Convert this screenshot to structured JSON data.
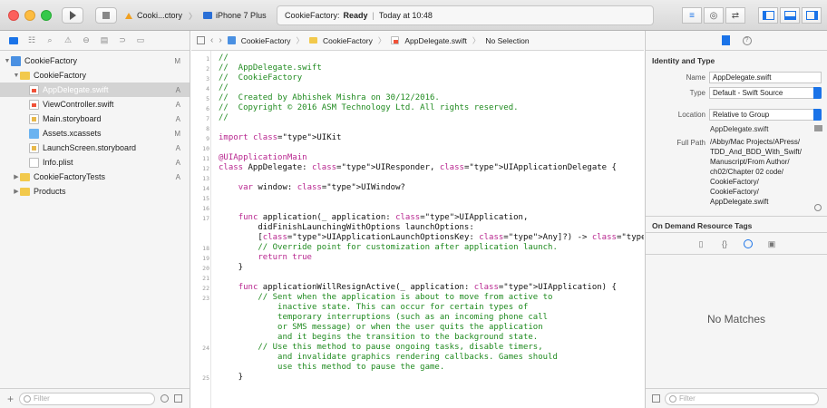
{
  "toolbar": {
    "scheme": "Cooki...ctory",
    "device": "iPhone 7 Plus",
    "activity_project": "CookieFactory:",
    "activity_status": "Ready",
    "activity_time": "Today at 10:48"
  },
  "navigator": {
    "items": [
      {
        "label": "CookieFactory",
        "badge": "M"
      },
      {
        "label": "CookieFactory",
        "badge": ""
      },
      {
        "label": "AppDelegate.swift",
        "badge": "A"
      },
      {
        "label": "ViewController.swift",
        "badge": "A"
      },
      {
        "label": "Main.storyboard",
        "badge": "A"
      },
      {
        "label": "Assets.xcassets",
        "badge": "M"
      },
      {
        "label": "LaunchScreen.storyboard",
        "badge": "A"
      },
      {
        "label": "Info.plist",
        "badge": "A"
      },
      {
        "label": "CookieFactoryTests",
        "badge": "A"
      },
      {
        "label": "Products",
        "badge": ""
      }
    ],
    "filter_placeholder": "Filter"
  },
  "jumpbar": {
    "crumb1": "CookieFactory",
    "crumb2": "CookieFactory",
    "crumb3": "AppDelegate.swift",
    "crumb4": "No Selection"
  },
  "code": {
    "line_numbers": [
      "1",
      "2",
      "3",
      "4",
      "5",
      "6",
      "7",
      "8",
      "9",
      "10",
      "11",
      "12",
      "13",
      "14",
      "15",
      "16",
      "17",
      "18",
      "19",
      "20",
      "21",
      "22",
      "23",
      "24",
      "25"
    ],
    "lines": [
      "//",
      "//  AppDelegate.swift",
      "//  CookieFactory",
      "//",
      "//  Created by Abhishek Mishra on 30/12/2016.",
      "//  Copyright © 2016 ASM Technology Ltd. All rights reserved.",
      "//",
      "",
      "import UIKit",
      "",
      "@UIApplicationMain",
      "class AppDelegate: UIResponder, UIApplicationDelegate {",
      "",
      "    var window: UIWindow?",
      "",
      "",
      "    func application(_ application: UIApplication,",
      "        didFinishLaunchingWithOptions launchOptions:",
      "        [UIApplicationLaunchOptionsKey: Any]?) -> Bool {",
      "        // Override point for customization after application launch.",
      "        return true",
      "    }",
      "",
      "    func applicationWillResignActive(_ application: UIApplication) {",
      "        // Sent when the application is about to move from active to",
      "            inactive state. This can occur for certain types of",
      "            temporary interruptions (such as an incoming phone call",
      "            or SMS message) or when the user quits the application",
      "            and it begins the transition to the background state.",
      "        // Use this method to pause ongoing tasks, disable timers,",
      "            and invalidate graphics rendering callbacks. Games should",
      "            use this method to pause the game.",
      "    }"
    ]
  },
  "inspector": {
    "identity_title": "Identity and Type",
    "name_label": "Name",
    "name_value": "AppDelegate.swift",
    "type_label": "Type",
    "type_value": "Default - Swift Source",
    "location_label": "Location",
    "location_value": "Relative to Group",
    "location_file": "AppDelegate.swift",
    "fullpath_label": "Full Path",
    "fullpath_lines": [
      "/Abby/Mac Projects/APress/",
      "TDD_And_BDD_With_Swift/",
      "Manuscript/From Author/",
      "ch02/Chapter 02 code/",
      "CookieFactory/",
      "CookieFactory/",
      "AppDelegate.swift"
    ],
    "odr_title": "On Demand Resource Tags",
    "no_matches": "No Matches",
    "filter_placeholder": "Filter"
  }
}
